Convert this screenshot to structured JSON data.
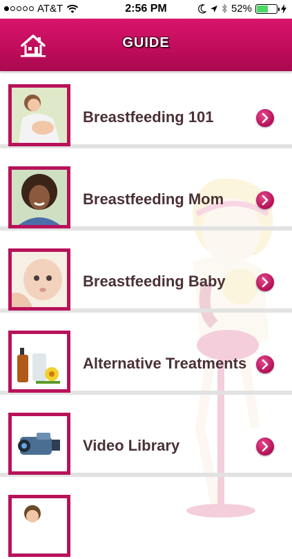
{
  "status_bar": {
    "carrier": "AT&T",
    "time": "2:56 PM",
    "battery": "52%",
    "icons": [
      "signal-dots-icon",
      "wifi-icon",
      "moon-icon",
      "location-arrow-icon",
      "bluetooth-icon",
      "battery-icon",
      "charging-bolt-icon"
    ]
  },
  "nav": {
    "title": "GUIDE",
    "home_icon": "home-icon"
  },
  "colors": {
    "brand": "#c10c5c",
    "label_text": "#4a3136",
    "divider": "#e2e2e2"
  },
  "list": {
    "items": [
      {
        "label": "Breastfeeding 101",
        "thumb": "mother-nursing-photo",
        "chevron": "chevron-right-icon"
      },
      {
        "label": "Breastfeeding Mom",
        "thumb": "smiling-woman-photo",
        "chevron": "chevron-right-icon"
      },
      {
        "label": "Breastfeeding Baby",
        "thumb": "baby-photo",
        "chevron": "chevron-right-icon"
      },
      {
        "label": "Alternative Treatments",
        "thumb": "oil-bottle-flowers-photo",
        "chevron": "chevron-right-icon"
      },
      {
        "label": "Video Library",
        "thumb": "video-camera-photo",
        "chevron": "chevron-right-icon"
      },
      {
        "label": "",
        "thumb": "child-photo",
        "chevron": ""
      }
    ]
  }
}
